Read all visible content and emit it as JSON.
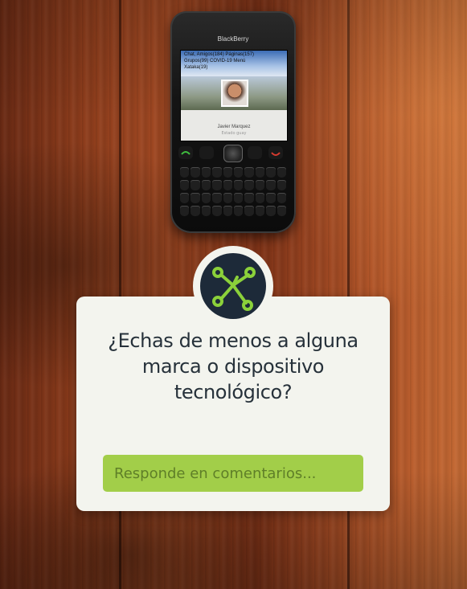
{
  "story": {
    "phone": {
      "brand": "BlackBerry",
      "screen_lines": [
        "Chat, Amigos(184) Páginas(157)",
        "Grupos(99)  COVID-19  Menú",
        "Xataka(19)"
      ],
      "contact_name": "Javier Marquez",
      "contact_sub": "Estado guay"
    },
    "question": {
      "line1": "¿Echas de menos a alguna",
      "line2": "marca o dispositivo",
      "line3": "tecnológico?"
    },
    "reply": {
      "placeholder": "Responde en comentarios..."
    },
    "badge_icon": "xataka-x-logo-icon",
    "colors": {
      "card": "#f3f4ee",
      "badge": "#1d2a39",
      "accent": "#8bd13a",
      "reply_bg": "#a2ce49"
    }
  }
}
